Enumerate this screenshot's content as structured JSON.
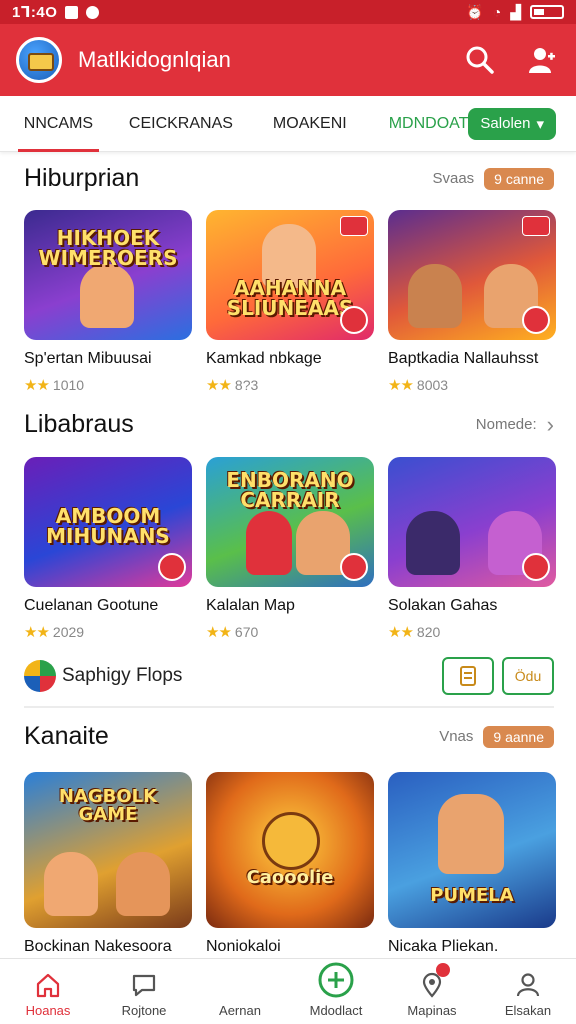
{
  "status_bar": {
    "time": "1Ꞁ:4O"
  },
  "app_bar": {
    "title": "Matlkidognlqian",
    "logo_icon": "game-controller-logo",
    "actions": [
      "search-icon",
      "user-profile-icon"
    ]
  },
  "tabs": [
    {
      "label": "NNCAMS",
      "active": true
    },
    {
      "label": "CEICKRANAS",
      "active": false
    },
    {
      "label": "MOAKENI",
      "active": false
    },
    {
      "label": "MDNDOAT",
      "active": false,
      "color": "#2aa14a"
    }
  ],
  "tab_select": {
    "label": "Salolen"
  },
  "sections": [
    {
      "title": "Hiburprian",
      "more_label": "Svaas",
      "pill_label": "9 canne",
      "cards": [
        {
          "name": "Sp'ertan Mibuusai",
          "rating": "1010",
          "thumb_text": "HIKHOEK WIMEROERS"
        },
        {
          "name": "Kamkad nbkage",
          "rating": "8?3",
          "thumb_text": "AAHANNA SLIUNEAAS"
        },
        {
          "name": "Baptkadia Nallauhsst",
          "rating": "8003",
          "thumb_text": ""
        }
      ]
    },
    {
      "title": "Libabraus",
      "more_label": "Nomede:",
      "cards": [
        {
          "name": "Cuelanan Gootune",
          "rating": "2029",
          "thumb_text": "AMBOOM MIHUNANS"
        },
        {
          "name": "Kalalan Map",
          "rating": "670",
          "thumb_text": "ENBORANO CARRAIR"
        },
        {
          "name": "Solakan Gahas",
          "rating": "820",
          "thumb_text": ""
        }
      ]
    },
    {
      "title": "Kanaite",
      "more_label": "Vnas",
      "pill_label": "9 aanne",
      "cards": [
        {
          "name": "Bockinan Nakesoora",
          "thumb_text": "NAGBOLK GAME"
        },
        {
          "name": "Noniokaloi",
          "thumb_text": "Caooolie"
        },
        {
          "name": "Nicaka Pliekan.",
          "thumb_text": "PUMELA"
        }
      ]
    }
  ],
  "promo": {
    "text": "Saphigy Flops",
    "btn2_label": "Ödu"
  },
  "bottom_nav": [
    {
      "label": "Hoanas",
      "icon": "home-icon",
      "active": true
    },
    {
      "label": "Rojtone",
      "icon": "chat-icon",
      "active": false
    },
    {
      "label": "Aernan",
      "icon": "",
      "active": false
    },
    {
      "label": "Mdodlact",
      "icon": "add-circle-icon",
      "active": false
    },
    {
      "label": "Mapinas",
      "icon": "location-icon",
      "active": false
    },
    {
      "label": "Elsakan",
      "icon": "profile-icon",
      "active": false
    }
  ],
  "colors": {
    "primary": "#e0313b",
    "accent_green": "#2aa14a",
    "star": "#f2b417",
    "pill": "#d9894f"
  }
}
